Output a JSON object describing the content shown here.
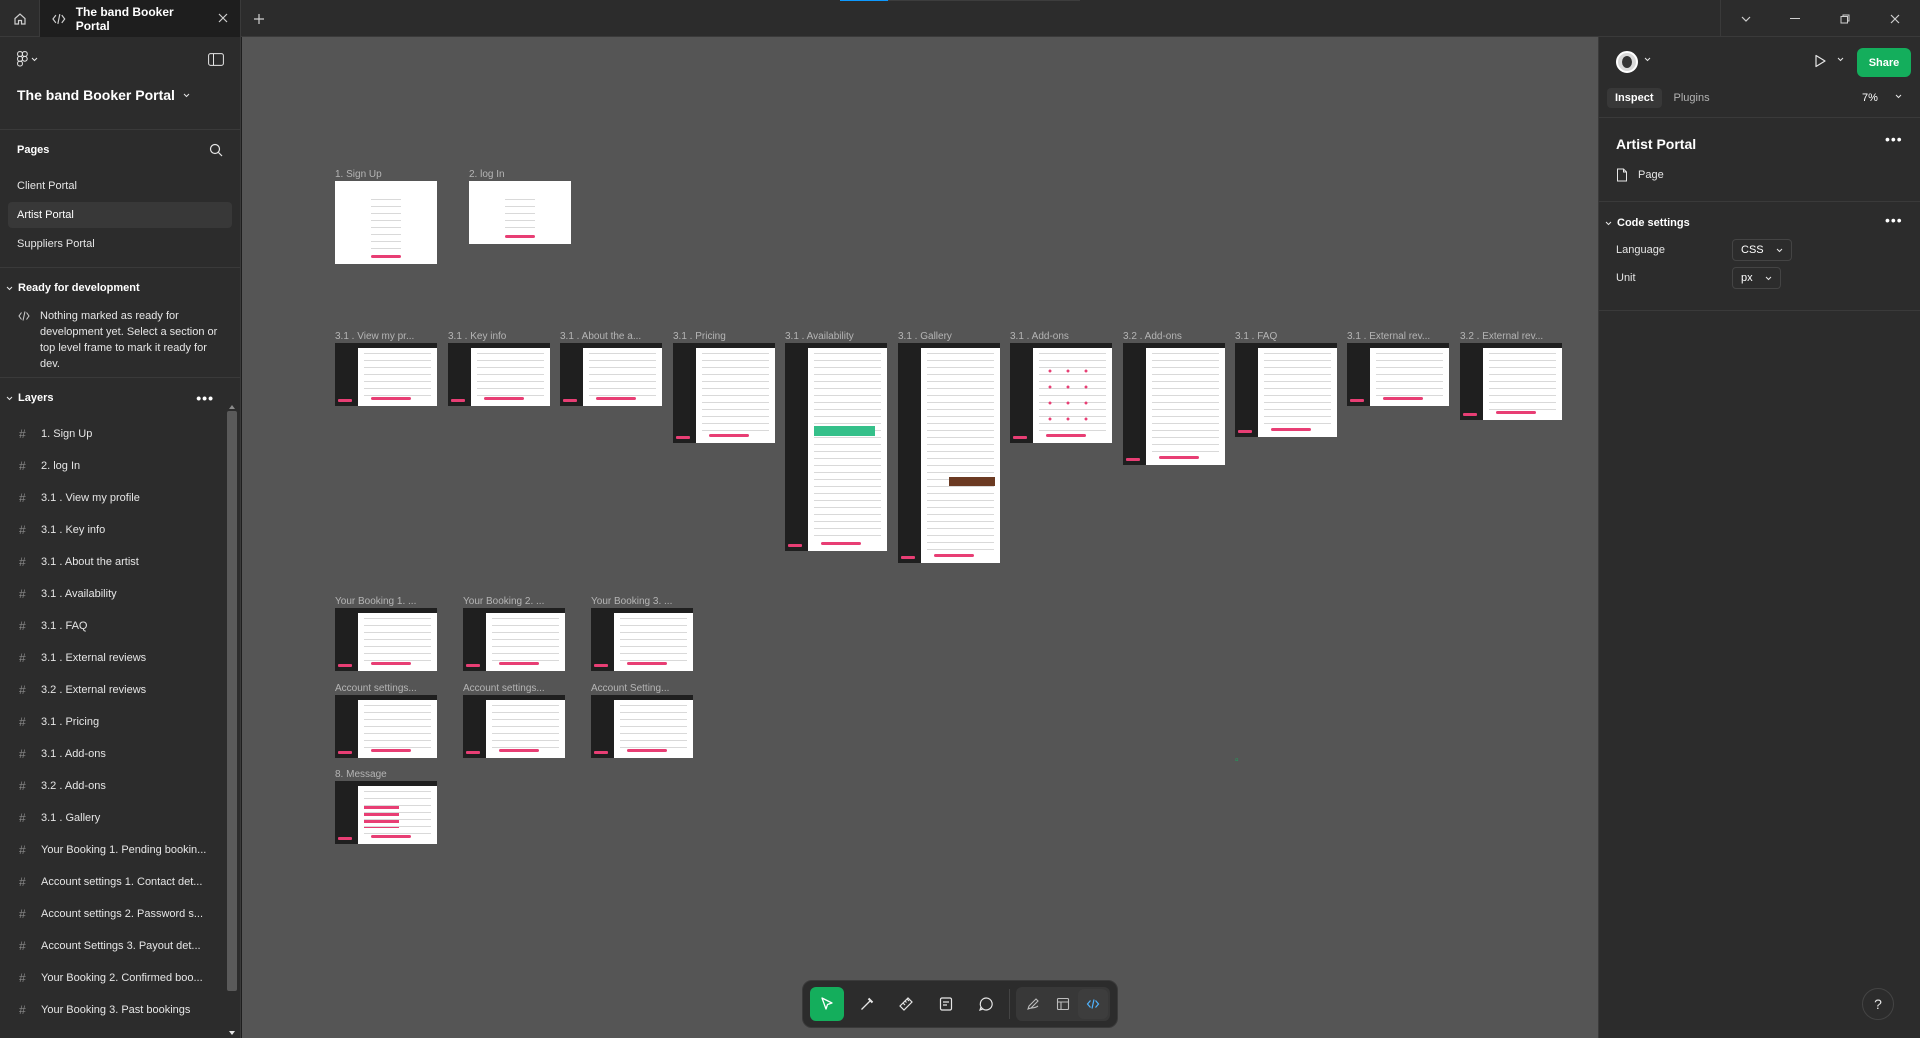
{
  "titlebar": {
    "tab_title": "The band Booker Portal"
  },
  "left_panel": {
    "file_name": "The band Booker Portal",
    "pages_title": "Pages",
    "pages": [
      {
        "label": "Client Portal",
        "active": false
      },
      {
        "label": "Artist Portal",
        "active": true
      },
      {
        "label": "Suppliers Portal",
        "active": false
      }
    ],
    "ready_title": "Ready for development",
    "ready_text": "Nothing marked as ready for development yet. Select a section or top level frame to mark it ready for dev.",
    "layers_title": "Layers",
    "layers": [
      "1. Sign Up",
      "2. log In",
      "3.1 . View my profile",
      "3.1 . Key info",
      "3.1 . About the artist",
      "3.1 . Availability",
      "3.1 . FAQ",
      "3.1 . External reviews",
      "3.2 . External reviews",
      "3.1 . Pricing",
      "3.1 . Add-ons",
      "3.2 . Add-ons",
      "3.1 . Gallery",
      "Your Booking 1. Pending bookin...",
      "Account settings 1. Contact det...",
      "Account settings 2. Password s...",
      "Account Settings 3. Payout det...",
      "Your Booking 2. Confirmed boo...",
      "Your Booking 3. Past bookings"
    ]
  },
  "canvas": {
    "frames": [
      "1. Sign Up",
      "2. log In",
      "3.1 . View my pr...",
      "3.1 . Key info",
      "3.1 . About the a...",
      "3.1 . Pricing",
      "3.1 . Availability",
      "3.1 . Gallery",
      "3.1 . Add-ons",
      "3.2 . Add-ons",
      "3.1 . FAQ",
      "3.1 . External rev...",
      "3.2 . External rev...",
      "Your Booking 1. ...",
      "Your Booking 2. ...",
      "Your Booking 3. ...",
      "Account settings...",
      "Account settings...",
      "Account Setting...",
      "8. Message"
    ]
  },
  "right_panel": {
    "share_label": "Share",
    "tabs": [
      "Inspect",
      "Plugins"
    ],
    "zoom": "7%",
    "page_title": "Artist Portal",
    "page_type": "Page",
    "code_settings_title": "Code settings",
    "language_label": "Language",
    "language_value": "CSS",
    "unit_label": "Unit",
    "unit_value": "px"
  },
  "help_label": "?",
  "colors": {
    "accent_green": "#14ae5c",
    "brand_pink": "#e83e74",
    "canvas": "#555555",
    "panel": "#2c2c2c"
  }
}
